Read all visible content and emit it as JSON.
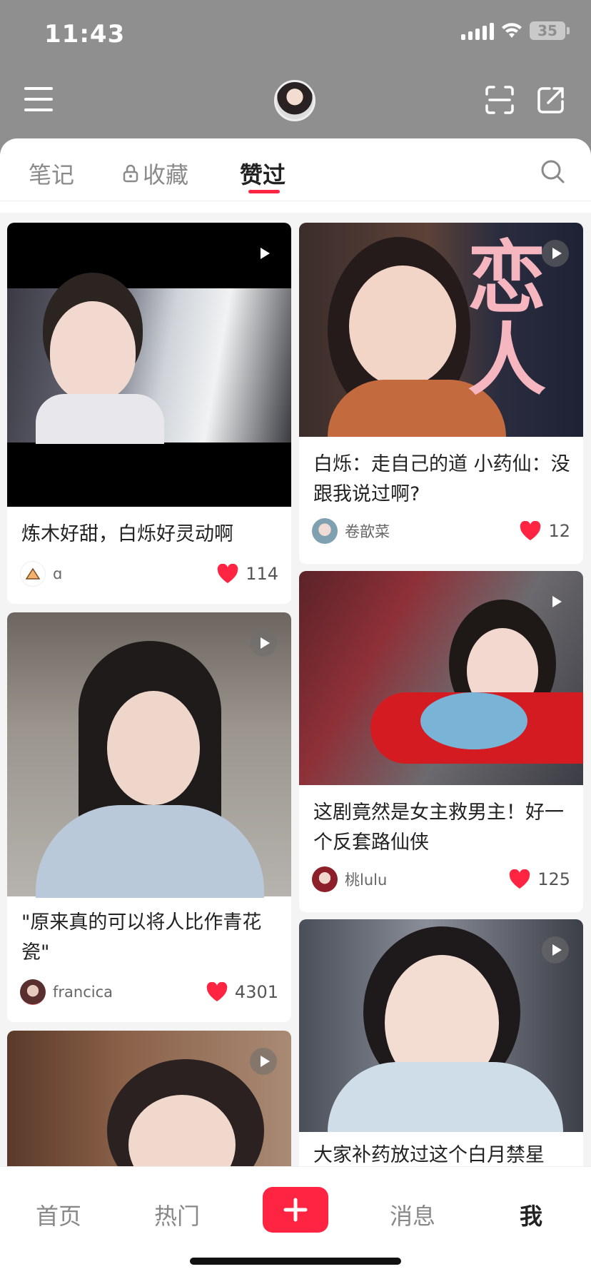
{
  "status": {
    "time": "11:43",
    "battery": "35"
  },
  "tabs": [
    {
      "label": "笔记"
    },
    {
      "label": "收藏"
    },
    {
      "label": "赞过"
    }
  ],
  "colors": {
    "accent": "#ff2442",
    "topbar": "#8f8f8f"
  },
  "icons": {
    "menu": "menu-icon",
    "scan": "scan-icon",
    "share": "share-icon",
    "search": "search-icon",
    "lock": "lock-icon",
    "heart": "heart-icon",
    "play": "play-icon"
  },
  "feed": {
    "left": [
      {
        "title": "炼木好甜，白烁好灵动啊",
        "author": "ɑ",
        "likes": "114"
      },
      {
        "title": "\"原来真的可以将人比作青花瓷\"",
        "author": "francica",
        "likes": "4301"
      }
    ],
    "right": [
      {
        "title": "白烁：走自己的道 小药仙：没跟我说过啊?",
        "author": "卷歆菜",
        "likes": "12",
        "cover_text": "恋 人"
      },
      {
        "title": "这剧竟然是女主救男主！好一个反套路仙侠",
        "author": "桃lulu",
        "likes": "125"
      },
      {
        "title": "大家补药放过这个白月禁星"
      }
    ]
  },
  "bottom_nav": [
    {
      "label": "首页"
    },
    {
      "label": "热门"
    },
    {
      "label": "消息"
    },
    {
      "label": "我"
    }
  ]
}
